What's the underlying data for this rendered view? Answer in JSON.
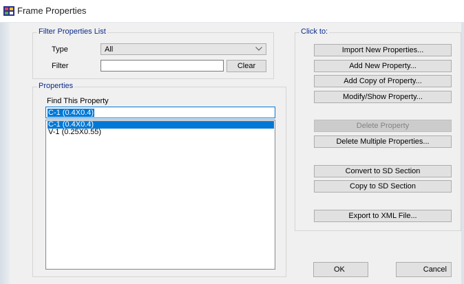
{
  "window": {
    "title": "Frame Properties"
  },
  "filter_group": {
    "legend": "Filter Properties List",
    "type_label": "Type",
    "type_value": "All",
    "filter_label": "Filter",
    "filter_value": "",
    "clear_label": "Clear"
  },
  "properties_group": {
    "legend": "Properties",
    "find_label": "Find This Property",
    "find_value": "C-1 (0.4X0.4)",
    "items": [
      {
        "label": "C-1 (0.4X0.4)",
        "selected": true
      },
      {
        "label": "V-1 (0.25X0.55)",
        "selected": false
      }
    ]
  },
  "click_to": {
    "legend": "Click to:",
    "import_label": "Import New Properties...",
    "add_new_label": "Add New Property...",
    "add_copy_label": "Add Copy of Property...",
    "modify_label": "Modify/Show Property...",
    "delete_label": "Delete Property",
    "delete_multiple_label": "Delete Multiple Properties...",
    "convert_sd_label": "Convert to SD Section",
    "copy_sd_label": "Copy to SD Section",
    "export_xml_label": "Export to XML File..."
  },
  "dialog_buttons": {
    "ok_label": "OK",
    "cancel_label": "Cancel"
  },
  "colors": {
    "accent": "#0078d7",
    "legend": "#0b2a8a",
    "disabled_button": "#cccccc"
  }
}
